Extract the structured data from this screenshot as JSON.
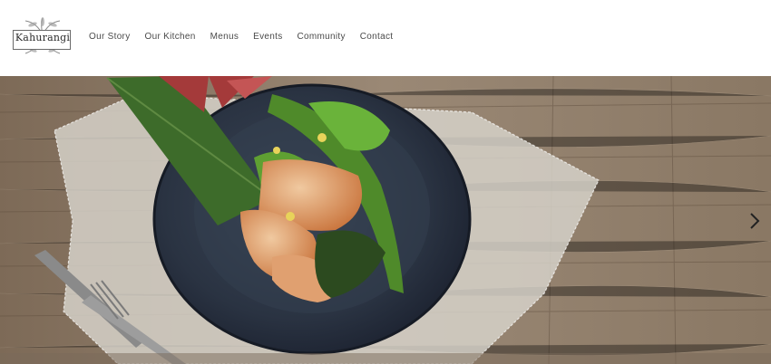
{
  "brand": {
    "name": "Kahurangi"
  },
  "nav": {
    "items": [
      {
        "label": "Our Story"
      },
      {
        "label": "Our Kitchen"
      },
      {
        "label": "Menus"
      },
      {
        "label": "Events"
      },
      {
        "label": "Community"
      },
      {
        "label": "Contact"
      }
    ]
  },
  "hero": {
    "icons": {
      "next": "chevron-right-icon"
    },
    "colors": {
      "wood": "#8b7560",
      "plate": "#2b3442",
      "greens": "#4f8a2a",
      "prawn": "#d58a4a"
    }
  }
}
